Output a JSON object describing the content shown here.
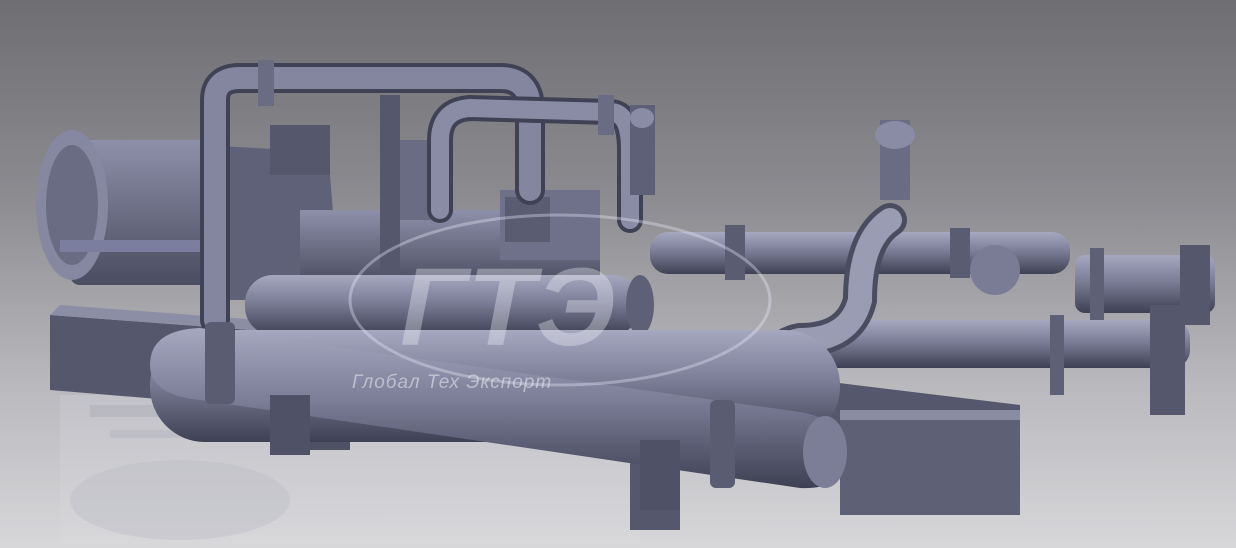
{
  "scene": {
    "subject": "turbine-compressor-unit-render",
    "watermark": {
      "logo_text": "ГТЭ",
      "caption": "Глобал Тех Экспорт"
    },
    "colors": {
      "metal": "#6d6f88",
      "metal_light": "#9ea0b8",
      "metal_dark": "#3f4154",
      "background_top": "#6f6f73",
      "background_bottom": "#d7d7da"
    }
  }
}
